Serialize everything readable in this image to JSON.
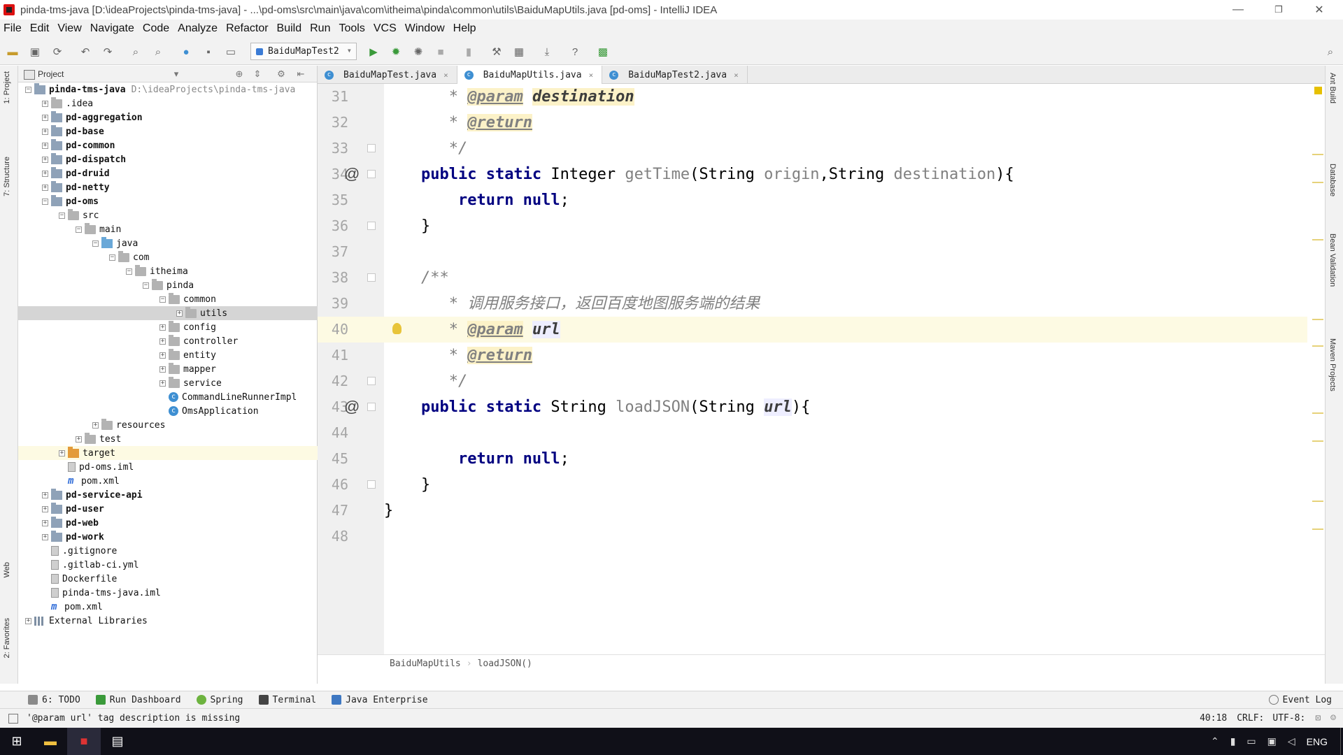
{
  "window": {
    "title": "pinda-tms-java [D:\\ideaProjects\\pinda-tms-java] - ...\\pd-oms\\src\\main\\java\\com\\itheima\\pinda\\common\\utils\\BaiduMapUtils.java [pd-oms] - IntelliJ IDEA",
    "min": "—",
    "max": "❐",
    "close": "✕"
  },
  "menu": [
    "File",
    "Edit",
    "View",
    "Navigate",
    "Code",
    "Analyze",
    "Refactor",
    "Build",
    "Run",
    "Tools",
    "VCS",
    "Window",
    "Help"
  ],
  "toolbar": {
    "run_config": "BaiduMapTest2"
  },
  "side_tabs": {
    "left": [
      "1: Project",
      "7: Structure",
      "Web",
      "2: Favorites"
    ],
    "right": [
      "Ant Build",
      "Database",
      "Bean Validation",
      "Maven Projects"
    ]
  },
  "project": {
    "header": "Project",
    "tree": [
      {
        "label": "pinda-tms-java",
        "path": "D:\\ideaProjects\\pinda-tms-java",
        "depth": 0,
        "icon": "module",
        "toggle": "−",
        "bold": true
      },
      {
        "label": ".idea",
        "depth": 1,
        "icon": "folder",
        "toggle": "+"
      },
      {
        "label": "pd-aggregation",
        "depth": 1,
        "icon": "module",
        "toggle": "+",
        "bold": true
      },
      {
        "label": "pd-base",
        "depth": 1,
        "icon": "module",
        "toggle": "+",
        "bold": true
      },
      {
        "label": "pd-common",
        "depth": 1,
        "icon": "module",
        "toggle": "+",
        "bold": true
      },
      {
        "label": "pd-dispatch",
        "depth": 1,
        "icon": "module",
        "toggle": "+",
        "bold": true
      },
      {
        "label": "pd-druid",
        "depth": 1,
        "icon": "module",
        "toggle": "+",
        "bold": true
      },
      {
        "label": "pd-netty",
        "depth": 1,
        "icon": "module",
        "toggle": "+",
        "bold": true
      },
      {
        "label": "pd-oms",
        "depth": 1,
        "icon": "module",
        "toggle": "−",
        "bold": true
      },
      {
        "label": "src",
        "depth": 2,
        "icon": "folder",
        "toggle": "−"
      },
      {
        "label": "main",
        "depth": 3,
        "icon": "folder",
        "toggle": "−"
      },
      {
        "label": "java",
        "depth": 4,
        "icon": "blue",
        "toggle": "−"
      },
      {
        "label": "com",
        "depth": 5,
        "icon": "folder",
        "toggle": "−"
      },
      {
        "label": "itheima",
        "depth": 6,
        "icon": "folder",
        "toggle": "−"
      },
      {
        "label": "pinda",
        "depth": 7,
        "icon": "folder",
        "toggle": "−"
      },
      {
        "label": "common",
        "depth": 8,
        "icon": "folder",
        "toggle": "−"
      },
      {
        "label": "utils",
        "depth": 9,
        "icon": "folder",
        "toggle": "+",
        "selected": true
      },
      {
        "label": "config",
        "depth": 8,
        "icon": "folder",
        "toggle": "+"
      },
      {
        "label": "controller",
        "depth": 8,
        "icon": "folder",
        "toggle": "+"
      },
      {
        "label": "entity",
        "depth": 8,
        "icon": "folder",
        "toggle": "+"
      },
      {
        "label": "mapper",
        "depth": 8,
        "icon": "folder",
        "toggle": "+"
      },
      {
        "label": "service",
        "depth": 8,
        "icon": "folder",
        "toggle": "+"
      },
      {
        "label": "CommandLineRunnerImpl",
        "depth": 8,
        "icon": "class",
        "toggle": ""
      },
      {
        "label": "OmsApplication",
        "depth": 8,
        "icon": "class",
        "toggle": ""
      },
      {
        "label": "resources",
        "depth": 4,
        "icon": "folder",
        "toggle": "+"
      },
      {
        "label": "test",
        "depth": 3,
        "icon": "folder",
        "toggle": "+"
      },
      {
        "label": "target",
        "depth": 2,
        "icon": "orange",
        "toggle": "+",
        "highlight": true
      },
      {
        "label": "pd-oms.iml",
        "depth": 2,
        "icon": "file",
        "toggle": ""
      },
      {
        "label": "pom.xml",
        "depth": 2,
        "icon": "m",
        "toggle": ""
      },
      {
        "label": "pd-service-api",
        "depth": 1,
        "icon": "module",
        "toggle": "+",
        "bold": true
      },
      {
        "label": "pd-user",
        "depth": 1,
        "icon": "module",
        "toggle": "+",
        "bold": true
      },
      {
        "label": "pd-web",
        "depth": 1,
        "icon": "module",
        "toggle": "+",
        "bold": true
      },
      {
        "label": "pd-work",
        "depth": 1,
        "icon": "module",
        "toggle": "+",
        "bold": true
      },
      {
        "label": ".gitignore",
        "depth": 1,
        "icon": "file",
        "toggle": ""
      },
      {
        "label": ".gitlab-ci.yml",
        "depth": 1,
        "icon": "file",
        "toggle": ""
      },
      {
        "label": "Dockerfile",
        "depth": 1,
        "icon": "file",
        "toggle": ""
      },
      {
        "label": "pinda-tms-java.iml",
        "depth": 1,
        "icon": "file",
        "toggle": ""
      },
      {
        "label": "pom.xml",
        "depth": 1,
        "icon": "m",
        "toggle": ""
      },
      {
        "label": "External Libraries",
        "depth": 0,
        "icon": "lib",
        "toggle": "+"
      }
    ]
  },
  "editor": {
    "tabs": [
      {
        "label": "BaiduMapTest.java",
        "active": false
      },
      {
        "label": "BaiduMapUtils.java",
        "active": true
      },
      {
        "label": "BaiduMapTest2.java",
        "active": false
      }
    ],
    "tab_close": "×",
    "lines": [
      {
        "n": "31",
        "segs": [
          [
            "cm",
            "       * "
          ],
          [
            "tag",
            "@param"
          ],
          [
            "cm",
            " "
          ],
          [
            "pv",
            "destination"
          ]
        ]
      },
      {
        "n": "32",
        "segs": [
          [
            "cm",
            "       * "
          ],
          [
            "tag",
            "@return"
          ]
        ]
      },
      {
        "n": "33",
        "segs": [
          [
            "cm",
            "       */"
          ]
        ],
        "fold": true
      },
      {
        "n": "34",
        "segs": [
          [
            "",
            "    "
          ],
          [
            "kw",
            "public static "
          ],
          [
            "ty",
            "Integer "
          ],
          [
            "fn",
            "getTime"
          ],
          [
            "ty",
            "(String "
          ],
          [
            "un",
            "origin"
          ],
          [
            "ty",
            ",String "
          ],
          [
            "un",
            "destination"
          ],
          [
            "ty",
            "){"
          ]
        ],
        "at": true,
        "fold": true
      },
      {
        "n": "35",
        "segs": [
          [
            "",
            "        "
          ],
          [
            "kw",
            "return null"
          ],
          [
            "ty",
            ";"
          ]
        ]
      },
      {
        "n": "36",
        "segs": [
          [
            "",
            "    }"
          ]
        ],
        "fold": true
      },
      {
        "n": "37",
        "segs": [
          [
            "",
            ""
          ]
        ]
      },
      {
        "n": "38",
        "segs": [
          [
            "cm",
            "    /**"
          ]
        ],
        "fold": true
      },
      {
        "n": "39",
        "segs": [
          [
            "cm",
            "       * 调用服务接口，返回百度地图服务端的结果"
          ]
        ]
      },
      {
        "n": "40",
        "segs": [
          [
            "cm",
            "       * "
          ],
          [
            "tag",
            "@param"
          ],
          [
            "cm",
            " "
          ],
          [
            "pv2",
            "url"
          ]
        ],
        "current": true,
        "bulb": true
      },
      {
        "n": "41",
        "segs": [
          [
            "cm",
            "       * "
          ],
          [
            "tag",
            "@return"
          ]
        ]
      },
      {
        "n": "42",
        "segs": [
          [
            "cm",
            "       */"
          ]
        ],
        "fold": true
      },
      {
        "n": "43",
        "segs": [
          [
            "",
            "    "
          ],
          [
            "kw",
            "public static "
          ],
          [
            "ty",
            "String "
          ],
          [
            "fn",
            "loadJSON"
          ],
          [
            "ty",
            "(String "
          ],
          [
            "pv2",
            "url"
          ],
          [
            "ty",
            "){"
          ]
        ],
        "at": true,
        "fold": true
      },
      {
        "n": "44",
        "segs": [
          [
            "",
            ""
          ]
        ]
      },
      {
        "n": "45",
        "segs": [
          [
            "",
            "        "
          ],
          [
            "kw",
            "return null"
          ],
          [
            "ty",
            ";"
          ]
        ]
      },
      {
        "n": "46",
        "segs": [
          [
            "",
            "    }"
          ]
        ],
        "fold": true
      },
      {
        "n": "47",
        "segs": [
          [
            "",
            "}"
          ]
        ]
      },
      {
        "n": "48",
        "segs": [
          [
            "",
            ""
          ]
        ]
      }
    ],
    "breadcrumb": [
      "BaiduMapUtils",
      "loadJSON()"
    ]
  },
  "bottom_tabs": [
    "6: TODO",
    "Run Dashboard",
    "Spring",
    "Terminal",
    "Java Enterprise"
  ],
  "event_log": "Event Log",
  "status": {
    "message": "'@param url' tag description is missing",
    "position": "40:18",
    "line_sep": "CRLF:",
    "encoding": "UTF-8:"
  },
  "taskbar": {
    "lang": "ENG"
  }
}
